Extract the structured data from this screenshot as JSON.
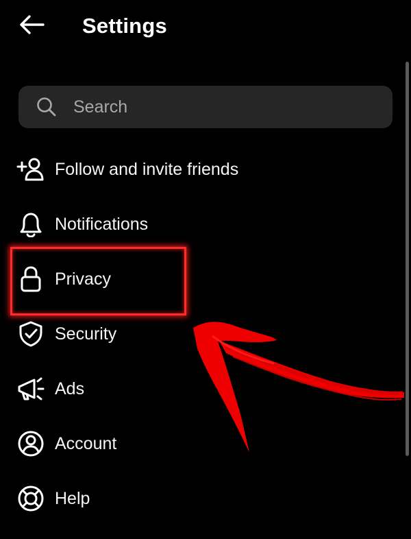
{
  "header": {
    "back_icon": "arrow-left-icon",
    "title": "Settings"
  },
  "search": {
    "icon": "search-icon",
    "placeholder": "Search"
  },
  "menu": {
    "items": [
      {
        "label": "Follow and invite friends",
        "icon": "add-person-icon"
      },
      {
        "label": "Notifications",
        "icon": "bell-icon"
      },
      {
        "label": "Privacy",
        "icon": "lock-icon"
      },
      {
        "label": "Security",
        "icon": "shield-check-icon"
      },
      {
        "label": "Ads",
        "icon": "megaphone-icon"
      },
      {
        "label": "Account",
        "icon": "user-circle-icon"
      },
      {
        "label": "Help",
        "icon": "lifebuoy-icon"
      }
    ]
  },
  "annotation": {
    "highlighted_item": "Privacy",
    "highlight_color": "#ff2a2a",
    "arrow_color": "#ee0000"
  },
  "colors": {
    "background": "#000000",
    "search_background": "#262626",
    "text": "#ffffff",
    "placeholder": "#a8a8a8"
  }
}
